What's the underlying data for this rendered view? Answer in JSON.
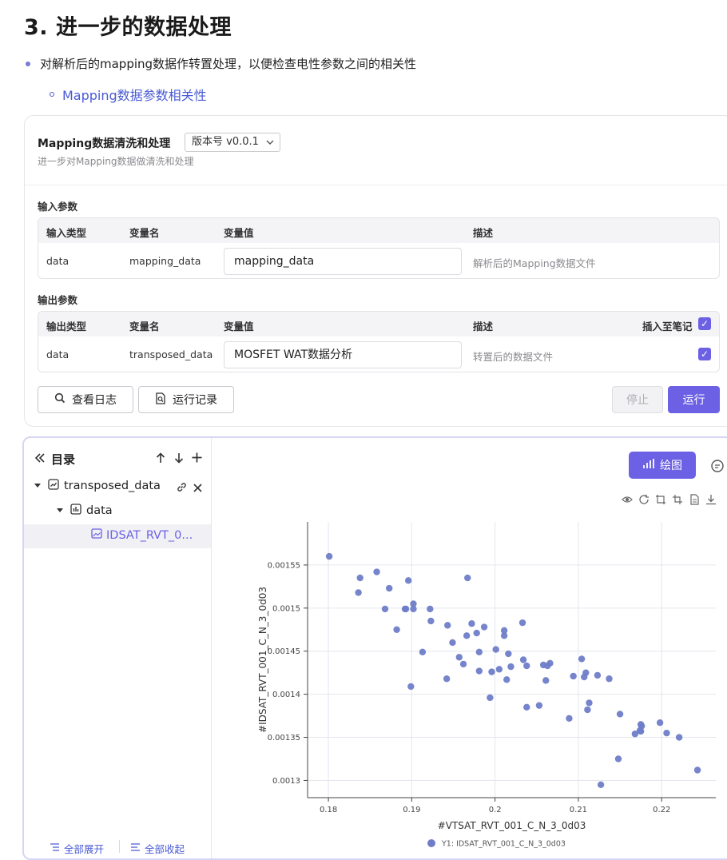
{
  "heading": "3. 进一步的数据处理",
  "bullet_main": "对解析后的mapping数据作转置处理，以便检查电性参数之间的相关性",
  "bullet_sub": "Mapping数据参数相关性",
  "card": {
    "title": "Mapping数据清洗和处理",
    "version": "版本号 v0.0.1",
    "subtitle": "进一步对Mapping数据做清洗和处理",
    "input_section": "输入参数",
    "input_headers": [
      "输入类型",
      "变量名",
      "变量值",
      "描述"
    ],
    "input_row": {
      "type": "data",
      "name": "mapping_data",
      "value": "mapping_data",
      "desc": "解析后的Mapping数据文件"
    },
    "output_section": "输出参数",
    "output_headers": [
      "输出类型",
      "变量名",
      "变量值",
      "描述",
      "插入至笔记"
    ],
    "output_row": {
      "type": "data",
      "name": "transposed_data",
      "value": "MOSFET WAT数据分析",
      "desc": "转置后的数据文件"
    },
    "buttons": {
      "logs": "查看日志",
      "history": "运行记录",
      "stop": "停止",
      "run": "运行"
    },
    "accent": "#6c61e4"
  },
  "sidebar": {
    "title": "目录",
    "tree": {
      "root": "transposed_data",
      "child": "data",
      "leaf": "IDSAT_RVT_0..."
    },
    "expand_all": "全部展开",
    "collapse_all": "全部收起"
  },
  "plot_button": "绘图",
  "chart_data": {
    "type": "scatter",
    "xlabel": "#VTSAT_RVT_001_C_N_3_0d03",
    "ylabel": "#IDSAT_RVT_001_C_N_3_0d03",
    "legend": "Y1: IDSAT_RVT_001_C_N_3_0d03",
    "legend_position": "bottom",
    "grid": true,
    "xlim": [
      0.1775,
      0.2265
    ],
    "ylim": [
      0.00128,
      0.0016
    ],
    "x_ticks": [
      0.18,
      0.19,
      0.2,
      0.21,
      0.22
    ],
    "x_tick_labels": [
      "0.18",
      "0.19",
      "0.2",
      "0.21",
      "0.22"
    ],
    "y_ticks": [
      0.0013,
      0.00135,
      0.0014,
      0.00145,
      0.0015,
      0.00155
    ],
    "y_tick_labels": [
      "0.0013",
      "0.00135",
      "0.0014",
      "0.00145",
      "0.0015",
      "0.00155"
    ],
    "color": "#6f7dc8",
    "points": [
      [
        0.1801,
        0.00156
      ],
      [
        0.1838,
        0.001535
      ],
      [
        0.1836,
        0.001518
      ],
      [
        0.1858,
        0.001542
      ],
      [
        0.1873,
        0.001523
      ],
      [
        0.1868,
        0.001499
      ],
      [
        0.1882,
        0.001475
      ],
      [
        0.1893,
        0.001499
      ],
      [
        0.1892,
        0.001499
      ],
      [
        0.1896,
        0.001532
      ],
      [
        0.1899,
        0.001409
      ],
      [
        0.1902,
        0.001505
      ],
      [
        0.1902,
        0.001499
      ],
      [
        0.1913,
        0.001449
      ],
      [
        0.1922,
        0.001499
      ],
      [
        0.1923,
        0.001485
      ],
      [
        0.1943,
        0.00148
      ],
      [
        0.1942,
        0.001418
      ],
      [
        0.1949,
        0.00146
      ],
      [
        0.1957,
        0.001443
      ],
      [
        0.1962,
        0.001435
      ],
      [
        0.1966,
        0.001468
      ],
      [
        0.1967,
        0.001535
      ],
      [
        0.1972,
        0.001482
      ],
      [
        0.1978,
        0.001471
      ],
      [
        0.1981,
        0.001449
      ],
      [
        0.1981,
        0.001427
      ],
      [
        0.1987,
        0.001478
      ],
      [
        0.1994,
        0.001396
      ],
      [
        0.1996,
        0.001426
      ],
      [
        0.2001,
        0.001452
      ],
      [
        0.2005,
        0.001429
      ],
      [
        0.2011,
        0.001474
      ],
      [
        0.2011,
        0.001468
      ],
      [
        0.2014,
        0.001417
      ],
      [
        0.2016,
        0.001447
      ],
      [
        0.2019,
        0.001432
      ],
      [
        0.2033,
        0.001483
      ],
      [
        0.2034,
        0.00144
      ],
      [
        0.2038,
        0.001433
      ],
      [
        0.2038,
        0.001385
      ],
      [
        0.2053,
        0.001387
      ],
      [
        0.2058,
        0.001434
      ],
      [
        0.2063,
        0.001433
      ],
      [
        0.2066,
        0.001436
      ],
      [
        0.2061,
        0.001416
      ],
      [
        0.2089,
        0.001372
      ],
      [
        0.2094,
        0.001421
      ],
      [
        0.2104,
        0.001441
      ],
      [
        0.2107,
        0.00142
      ],
      [
        0.2109,
        0.001425
      ],
      [
        0.2111,
        0.001382
      ],
      [
        0.2113,
        0.00139
      ],
      [
        0.2123,
        0.001422
      ],
      [
        0.2127,
        0.001295
      ],
      [
        0.2137,
        0.001418
      ],
      [
        0.2148,
        0.001325
      ],
      [
        0.215,
        0.001377
      ],
      [
        0.2168,
        0.001354
      ],
      [
        0.2174,
        0.001358
      ],
      [
        0.2175,
        0.001365
      ],
      [
        0.2176,
        0.001363
      ],
      [
        0.2175,
        0.001357
      ],
      [
        0.2198,
        0.001367
      ],
      [
        0.2206,
        0.001355
      ],
      [
        0.2221,
        0.00135
      ],
      [
        0.2243,
        0.001312
      ]
    ]
  }
}
